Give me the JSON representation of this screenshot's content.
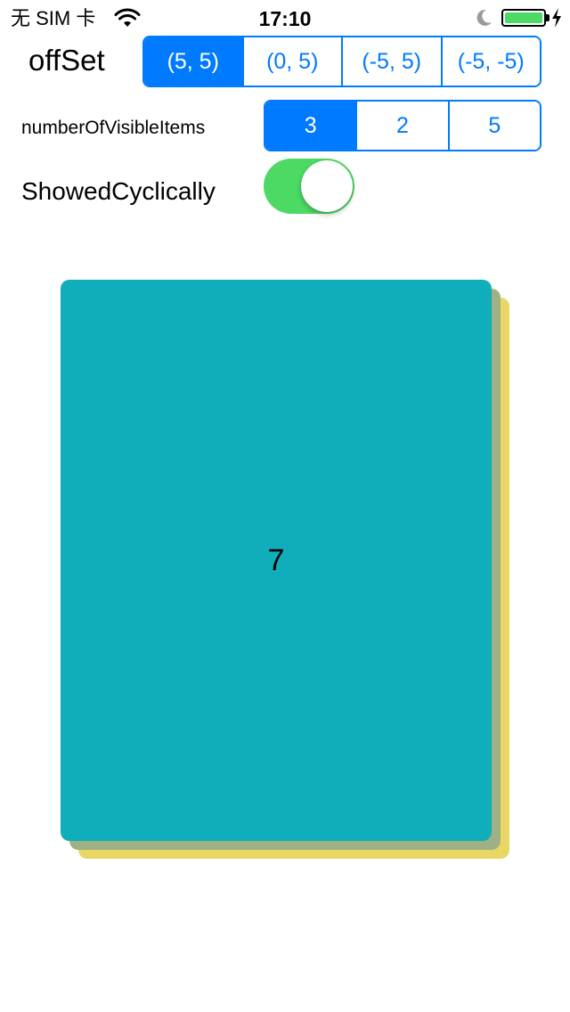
{
  "status_bar": {
    "carrier": "无 SIM 卡",
    "time": "17:10",
    "battery_level": 1.0,
    "battery_color": "#4cd964",
    "icons": [
      "wifi-icon",
      "moon-icon",
      "battery-icon",
      "charging-bolt-icon"
    ]
  },
  "offset": {
    "label": "offSet",
    "options": [
      "(5, 5)",
      "(0, 5)",
      "(-5, 5)",
      "(-5, -5)"
    ],
    "selected_index": 0
  },
  "visible_items": {
    "label": "numberOfVisibleItems",
    "options": [
      "3",
      "2",
      "5"
    ],
    "selected_index": 0
  },
  "cyclic": {
    "label": "ShowedCyclically",
    "on": true
  },
  "cards": {
    "front_label": "7",
    "colors": {
      "front": "#10aebb",
      "middle": "#9fb084",
      "back": "#e8d765"
    }
  },
  "colors": {
    "accent": "#007aff",
    "switch_on": "#4cd964"
  }
}
